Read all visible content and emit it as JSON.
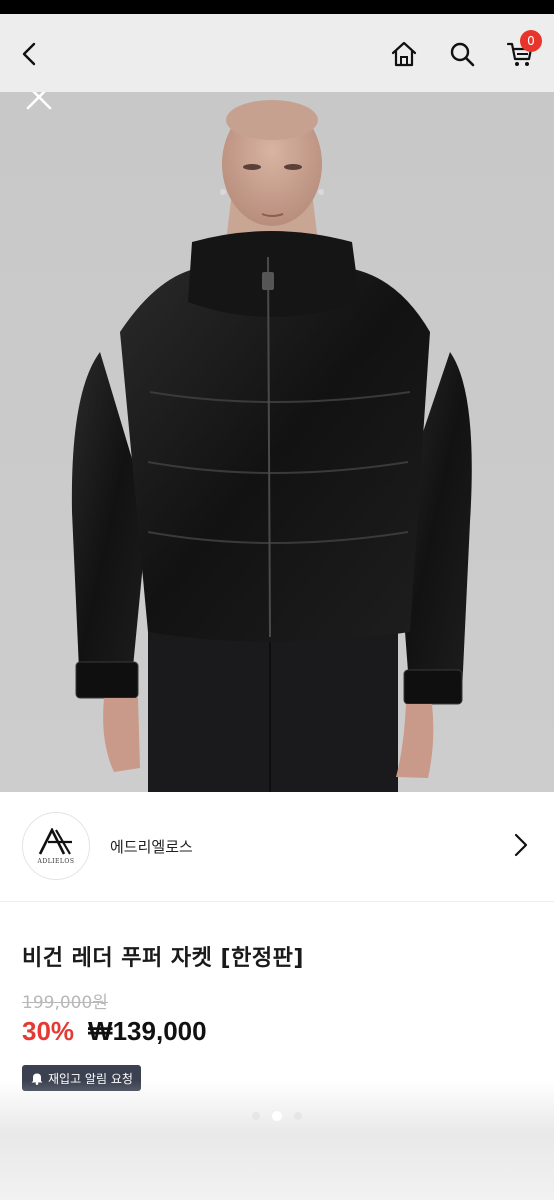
{
  "header": {
    "icons": [
      "chevron-left-icon",
      "home-icon",
      "search-icon",
      "cart-icon"
    ],
    "cart_count": "0",
    "badge_color": "#e8352b"
  },
  "hero": {
    "close_icon": "close-icon",
    "background_color": "#cbcbcb"
  },
  "brand": {
    "logo_text": "ADLIELOS",
    "name": "에드리엘로스"
  },
  "product": {
    "title": "비건 레더 푸퍼 자켓 [한정판]",
    "original_price": "199,000원",
    "discount": "30%",
    "sale_price": "₩139,000",
    "discount_color": "#e43a33"
  },
  "restock": {
    "icon": "bell-icon",
    "label": "재입고 알림 요청"
  },
  "gallery": {
    "dot_count": 3,
    "active_index": 1
  }
}
